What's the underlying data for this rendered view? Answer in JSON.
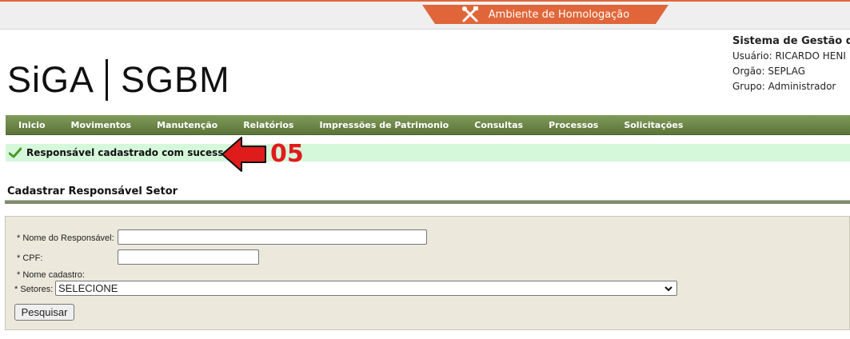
{
  "environment": {
    "label": "Ambiente de Homologação",
    "icon": "tools-icon",
    "color": "#e0663a"
  },
  "logo": {
    "left": "SiGA",
    "right": "SGBM"
  },
  "system_info": {
    "title": "Sistema de Gestão de",
    "user": "Usuário: RICARDO HENI",
    "org": "Orgão: SEPLAG",
    "group": "Grupo: Administrador"
  },
  "menu": [
    "Inicio",
    "Movimentos",
    "Manutenção",
    "Relatórios",
    "Impressões de Patrimonio",
    "Consultas",
    "Processos",
    "Solicitações"
  ],
  "success_message": "Responsável cadastrado com sucesso.",
  "annotation": {
    "step": "05",
    "color": "#e01b1b"
  },
  "section_title": "Cadastrar Responsável Setor",
  "form": {
    "nome_label": "* Nome do Responsável:",
    "nome_value": "",
    "cpf_label": "* CPF:",
    "cpf_value": "",
    "nome_cadastro_label": "* Nome cadastro:",
    "setores_label": "* Setores:",
    "setores_selected": "SELECIONE",
    "submit_label": "Pesquisar"
  }
}
